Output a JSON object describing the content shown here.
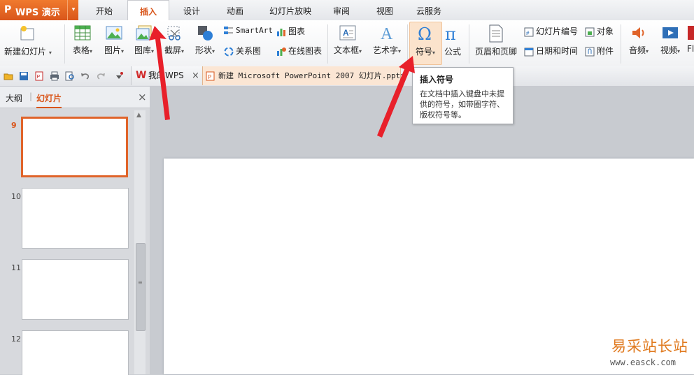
{
  "app": {
    "logo_glyph": "P",
    "logo_text": "WPS 演示",
    "logo_arrow": "▾"
  },
  "menu": [
    "开始",
    "插入",
    "设计",
    "动画",
    "幻灯片放映",
    "审阅",
    "视图",
    "云服务"
  ],
  "ribbon": {
    "new_slide": "新建幻灯片",
    "table": "表格",
    "picture": "图片",
    "gallery": "图库",
    "screenshot": "截屏",
    "shapes": "形状",
    "smartart": "SmartArt",
    "chart": "图表",
    "relation": "关系图",
    "online_chart": "在线图表",
    "textbox": "文本框",
    "wordart": "艺术字",
    "symbol": "符号",
    "formula": "公式",
    "header_footer": "页眉和页脚",
    "slide_number": "幻灯片编号",
    "date_time": "日期和时间",
    "object": "对象",
    "attachment": "附件",
    "audio": "音频",
    "video": "视频",
    "flash": "Fl"
  },
  "doc_tabs": {
    "home": "我的WPS",
    "close": "×",
    "current": "新建 Microsoft PowerPoint 2007 幻灯片.pptx"
  },
  "panel": {
    "outline": "大纲",
    "slides": "幻灯片",
    "close": "×",
    "numbers": [
      "9",
      "10",
      "11",
      "12"
    ]
  },
  "tooltip": {
    "title": "插入符号",
    "body": "在文档中插入键盘中未提供的符号，如带圈字符、版权符号等。"
  },
  "watermark": {
    "text": "易采站长站",
    "url": "www.easck.com"
  },
  "colors": {
    "accent": "#d9561b",
    "arrow": "#e8202a",
    "selected_border": "#e0642a"
  }
}
